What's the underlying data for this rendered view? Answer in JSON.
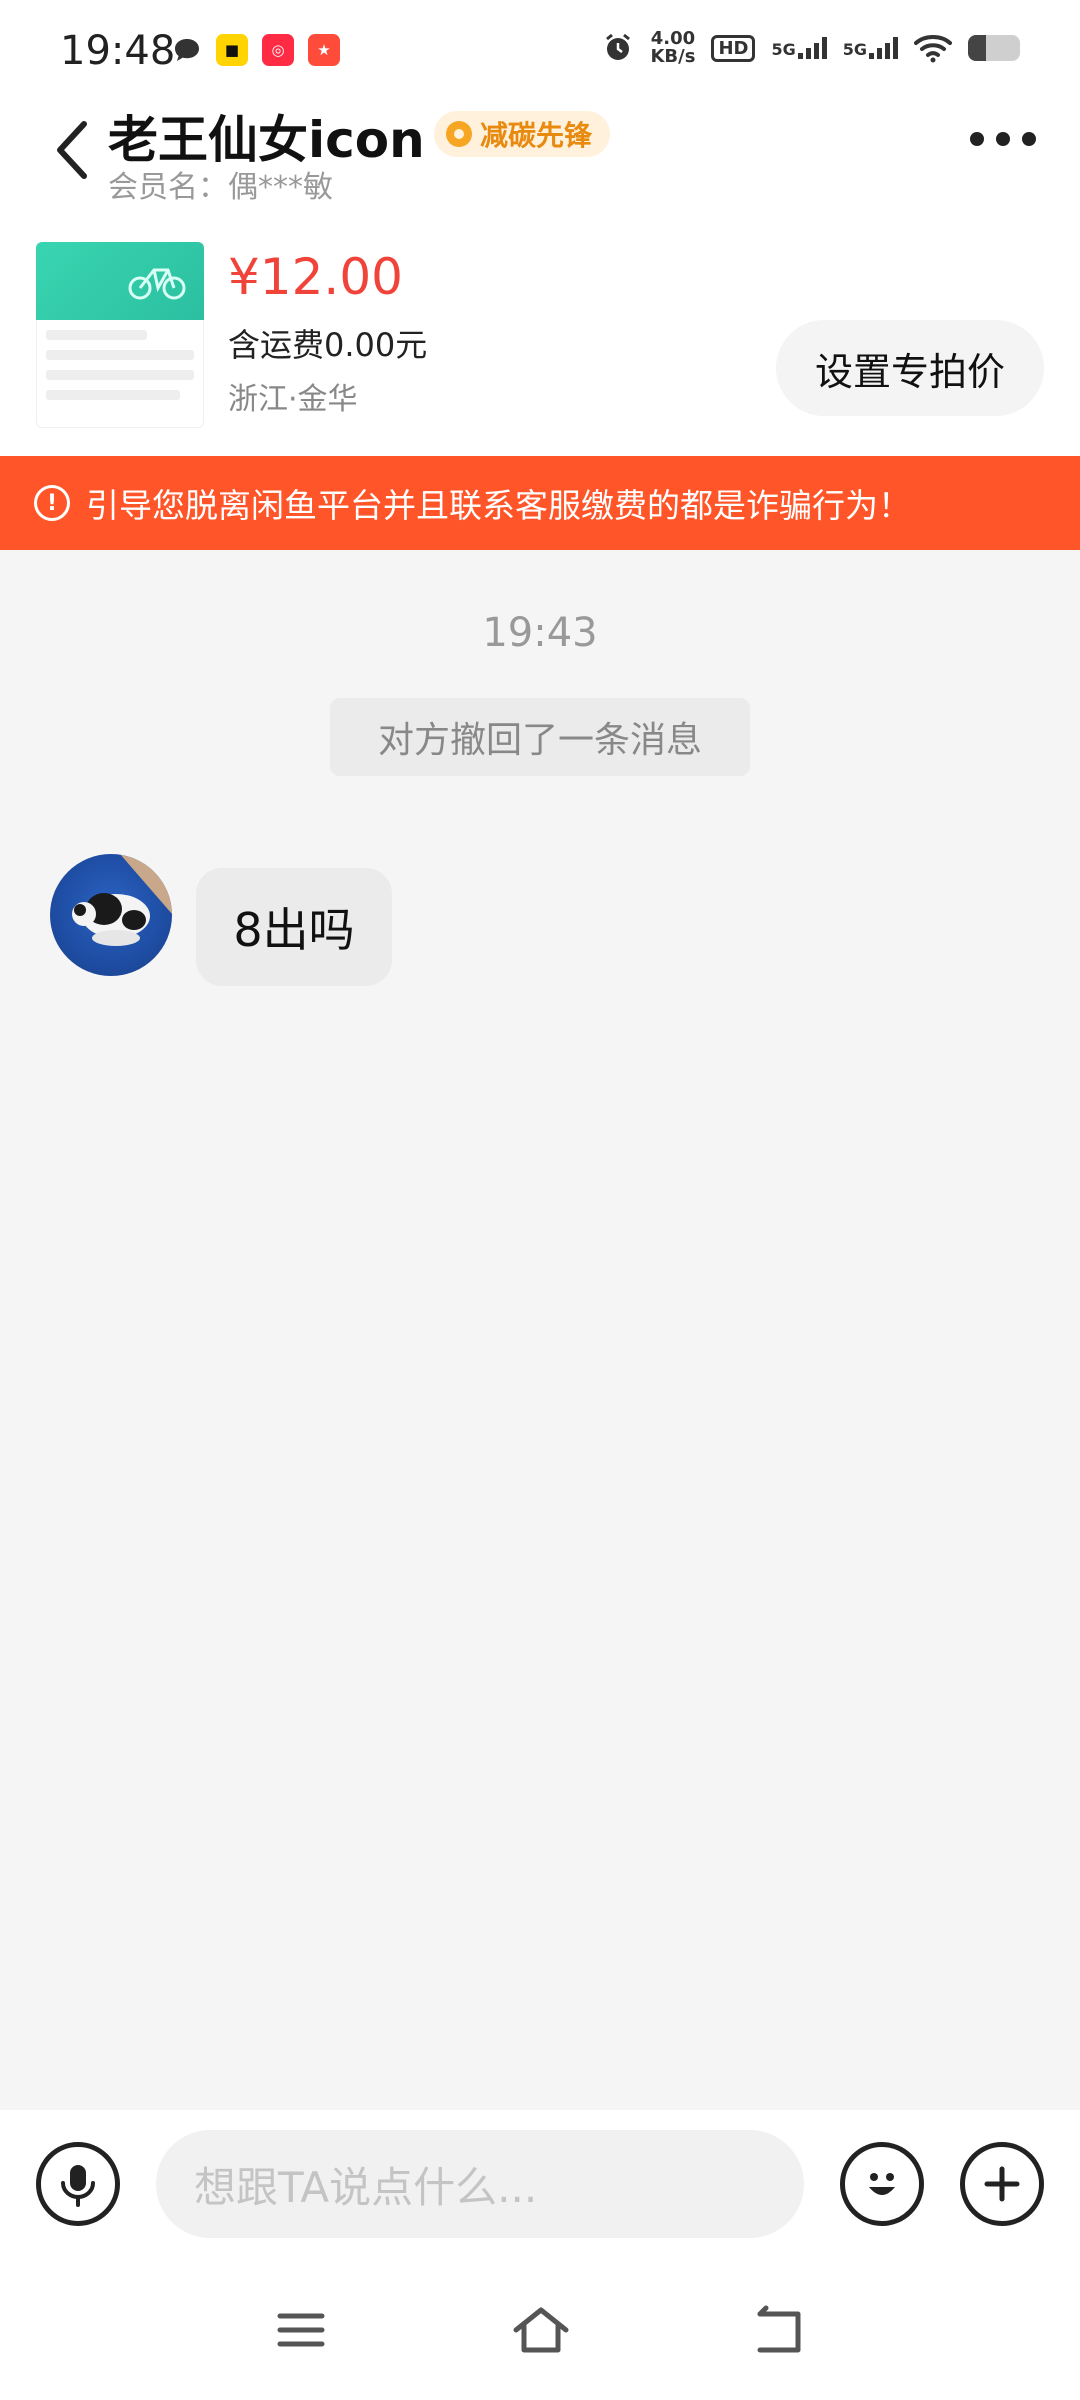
{
  "status_bar": {
    "time": "19:48",
    "net_speed_value": "4.00",
    "net_speed_unit": "KB/s",
    "hd": "HD",
    "network_1": "5G",
    "network_2": "5G",
    "battery_level": 0.35,
    "app_icons": [
      "message-icon",
      "app-yellow-icon",
      "app-red-icon",
      "app-game-icon"
    ]
  },
  "header": {
    "title": "老王仙女icon",
    "badge": "减碳先锋",
    "member_label": "会员名：偶***敏"
  },
  "product": {
    "price": "¥12.00",
    "shipping": "含运费0.00元",
    "location": "浙江·金华",
    "action_button": "设置专拍价"
  },
  "warning": {
    "text": "引导您脱离闲鱼平台并且联系客服缴费的都是诈骗行为！"
  },
  "chat": {
    "time_label": "19:43",
    "system_message": "对方撤回了一条消息",
    "messages": [
      {
        "text": "8出吗"
      }
    ]
  },
  "input": {
    "placeholder": "想跟TA说点什么..."
  },
  "colors": {
    "accent_red": "#f0443a",
    "warning_orange": "#ff5528",
    "badge_text": "#e88a0e"
  }
}
